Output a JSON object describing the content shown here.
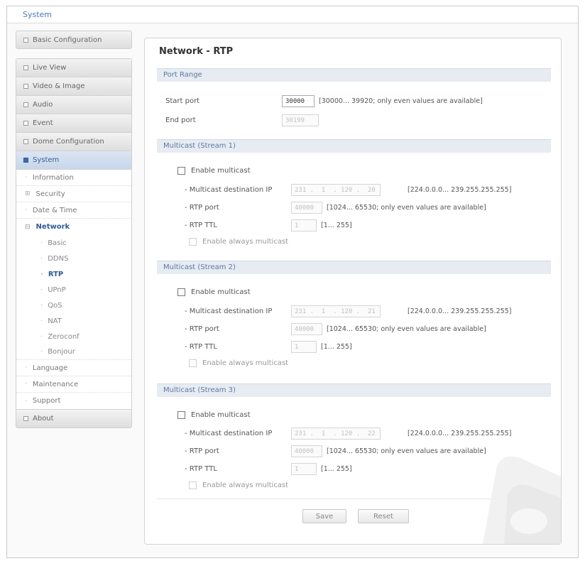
{
  "header": {
    "title": "System"
  },
  "sidebar": {
    "basic_configuration": "Basic Configuration",
    "items": [
      {
        "label": "Live View"
      },
      {
        "label": "Video & Image"
      },
      {
        "label": "Audio"
      },
      {
        "label": "Event"
      },
      {
        "label": "Dome Configuration"
      },
      {
        "label": "System"
      }
    ],
    "system_sub": [
      {
        "label": "Information"
      },
      {
        "label": "Security"
      },
      {
        "label": "Date & Time"
      },
      {
        "label": "Network"
      }
    ],
    "network_sub": [
      {
        "label": "Basic"
      },
      {
        "label": "DDNS"
      },
      {
        "label": "RTP"
      },
      {
        "label": "UPnP"
      },
      {
        "label": "QoS"
      },
      {
        "label": "NAT"
      },
      {
        "label": "Zeroconf"
      },
      {
        "label": "Bonjour"
      }
    ],
    "system_tail": [
      {
        "label": "Language"
      },
      {
        "label": "Maintenance"
      },
      {
        "label": "Support"
      }
    ],
    "about": "About"
  },
  "main": {
    "title": "Network - RTP",
    "port_range": {
      "heading": "Port Range",
      "start_label": "Start port",
      "start_value": "30000",
      "start_hint": "[30000... 39920; only even values are available]",
      "end_label": "End port",
      "end_value": "30199"
    },
    "streams": [
      {
        "heading": "Multicast (Stream 1)",
        "enable_label": "Enable multicast",
        "dest_label": "- Multicast destination IP",
        "dest_value": "231 .  1  . 120 .  20",
        "dest_hint": "[224.0.0.0... 239.255.255.255]",
        "port_label": "- RTP port",
        "port_value": "40000",
        "port_hint": "[1024... 65530; only even values are available]",
        "ttl_label": "- RTP TTL",
        "ttl_value": "1",
        "ttl_hint": "[1... 255]",
        "always_label": "Enable always multicast"
      },
      {
        "heading": "Multicast (Stream 2)",
        "enable_label": "Enable multicast",
        "dest_label": "- Multicast destination IP",
        "dest_value": "231 .  1  . 120 .  21",
        "dest_hint": "[224.0.0.0... 239.255.255.255]",
        "port_label": "- RTP port",
        "port_value": "40000",
        "port_hint": "[1024... 65530; only even values are available]",
        "ttl_label": "- RTP TTL",
        "ttl_value": "1",
        "ttl_hint": "[1... 255]",
        "always_label": "Enable always multicast"
      },
      {
        "heading": "Multicast (Stream 3)",
        "enable_label": "Enable multicast",
        "dest_label": "- Multicast destination IP",
        "dest_value": "231 .  1  . 120 .  22",
        "dest_hint": "[224.0.0.0... 239.255.255.255]",
        "port_label": "- RTP port",
        "port_value": "40000",
        "port_hint": "[1024... 65530; only even values are available]",
        "ttl_label": "- RTP TTL",
        "ttl_value": "1",
        "ttl_hint": "[1... 255]",
        "always_label": "Enable always multicast"
      }
    ],
    "save_label": "Save",
    "reset_label": "Reset"
  }
}
